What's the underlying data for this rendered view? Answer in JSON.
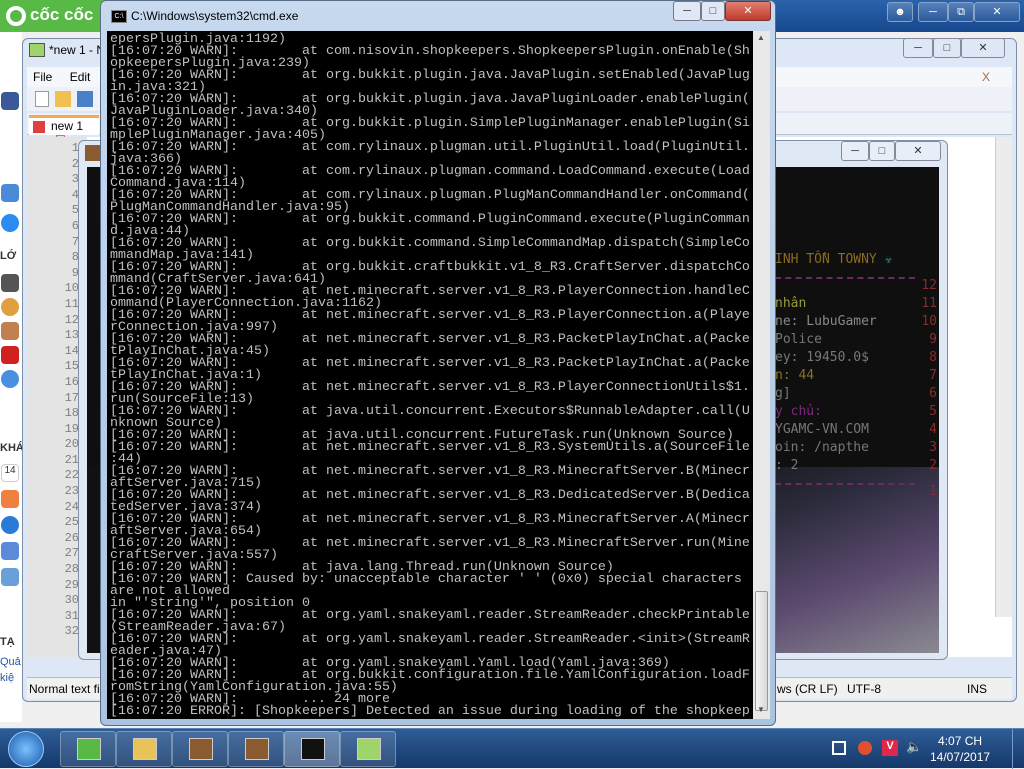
{
  "browser": {
    "logo": "cốc cốc"
  },
  "left_strip": {
    "labels": [
      "LỚ",
      "KHÁ",
      "TẠ",
      "Quả",
      "kiệ"
    ],
    "calendar_day": "14"
  },
  "notepad": {
    "title": "*new 1 - N",
    "menu": [
      "File",
      "Edit"
    ],
    "tab": "new 1",
    "line_numbers": [
      "1",
      "2",
      "3",
      "4",
      "5",
      "6",
      "7",
      "8",
      "9",
      "10",
      "11",
      "12",
      "13",
      "14",
      "15",
      "16",
      "17",
      "18",
      "19",
      "20",
      "21",
      "22",
      "23",
      "24",
      "25",
      "26",
      "27",
      "28",
      "29",
      "30",
      "31",
      "32"
    ],
    "status": {
      "type": "Normal text fi",
      "eol": "ws (CR LF)",
      "encoding": "UTF-8",
      "mode": "INS"
    }
  },
  "game": {
    "scoreboard": {
      "title": "INH TỒN TOWNY",
      "rows": [
        {
          "text": "nhân",
          "num": "11",
          "color": "#9a9a3a"
        },
        {
          "text": "ne: LubuGamer",
          "num": "10",
          "color": "#888"
        },
        {
          "text": "Police",
          "num": "9",
          "color": "#777"
        },
        {
          "text": "ey: 19450.0$",
          "num": "8",
          "color": "#777"
        },
        {
          "text": "n: 44",
          "num": "7",
          "color": "#8a7020"
        },
        {
          "text": "g]",
          "num": "6",
          "color": "#777"
        },
        {
          "text": "y chủ:",
          "num": "5",
          "color": "#7a2a7a"
        },
        {
          "text": "YGAMC-VN.COM",
          "num": "4",
          "color": "#777"
        },
        {
          "text": "oin: /napthe",
          "num": "3",
          "color": "#777"
        },
        {
          "text": ": 2",
          "num": "2",
          "color": "#777"
        }
      ],
      "top_num": "12",
      "bottom_num": "1"
    }
  },
  "cmd": {
    "title": "C:\\Windows\\system32\\cmd.exe",
    "rows": [
      "epersPlugin.java:1192)",
      "[16:07:20 WARN]:        at com.nisovin.shopkeepers.ShopkeepersPlugin.onEnable(Sh",
      "opkeepersPlugin.java:239)",
      "[16:07:20 WARN]:        at org.bukkit.plugin.java.JavaPlugin.setEnabled(JavaPlug",
      "in.java:321)",
      "[16:07:20 WARN]:        at org.bukkit.plugin.java.JavaPluginLoader.enablePlugin(",
      "JavaPluginLoader.java:340)",
      "[16:07:20 WARN]:        at org.bukkit.plugin.SimplePluginManager.enablePlugin(Si",
      "mplePluginManager.java:405)",
      "[16:07:20 WARN]:        at com.rylinaux.plugman.util.PluginUtil.load(PluginUtil.",
      "java:366)",
      "[16:07:20 WARN]:        at com.rylinaux.plugman.command.LoadCommand.execute(Load",
      "Command.java:114)",
      "[16:07:20 WARN]:        at com.rylinaux.plugman.PlugManCommandHandler.onCommand(",
      "PlugManCommandHandler.java:95)",
      "[16:07:20 WARN]:        at org.bukkit.command.PluginCommand.execute(PluginComman",
      "d.java:44)",
      "[16:07:20 WARN]:        at org.bukkit.command.SimpleCommandMap.dispatch(SimpleCo",
      "mmandMap.java:141)",
      "[16:07:20 WARN]:        at org.bukkit.craftbukkit.v1_8_R3.CraftServer.dispatchCo",
      "mmand(CraftServer.java:641)",
      "[16:07:20 WARN]:        at net.minecraft.server.v1_8_R3.PlayerConnection.handleC",
      "ommand(PlayerConnection.java:1162)",
      "[16:07:20 WARN]:        at net.minecraft.server.v1_8_R3.PlayerConnection.a(Playe",
      "rConnection.java:997)",
      "[16:07:20 WARN]:        at net.minecraft.server.v1_8_R3.PacketPlayInChat.a(Packe",
      "tPlayInChat.java:45)",
      "[16:07:20 WARN]:        at net.minecraft.server.v1_8_R3.PacketPlayInChat.a(Packe",
      "tPlayInChat.java:1)",
      "[16:07:20 WARN]:        at net.minecraft.server.v1_8_R3.PlayerConnectionUtils$1.",
      "run(SourceFile:13)",
      "[16:07:20 WARN]:        at java.util.concurrent.Executors$RunnableAdapter.call(U",
      "nknown Source)",
      "[16:07:20 WARN]:        at java.util.concurrent.FutureTask.run(Unknown Source)",
      "[16:07:20 WARN]:        at net.minecraft.server.v1_8_R3.SystemUtils.a(SourceFile",
      ":44)",
      "[16:07:20 WARN]:        at net.minecraft.server.v1_8_R3.MinecraftServer.B(Minecr",
      "aftServer.java:715)",
      "[16:07:20 WARN]:        at net.minecraft.server.v1_8_R3.DedicatedServer.B(Dedica",
      "tedServer.java:374)",
      "[16:07:20 WARN]:        at net.minecraft.server.v1_8_R3.MinecraftServer.A(Minecr",
      "aftServer.java:654)",
      "[16:07:20 WARN]:        at net.minecraft.server.v1_8_R3.MinecraftServer.run(Mine",
      "craftServer.java:557)",
      "[16:07:20 WARN]:        at java.lang.Thread.run(Unknown Source)",
      "[16:07:20 WARN]: Caused by: unacceptable character ' ' (0x0) special characters",
      "are not allowed",
      "in \"'string'\", position 0",
      "[16:07:20 WARN]:        at org.yaml.snakeyaml.reader.StreamReader.checkPrintable",
      "(StreamReader.java:67)",
      "[16:07:20 WARN]:        at org.yaml.snakeyaml.reader.StreamReader.<init>(StreamR",
      "eader.java:47)",
      "[16:07:20 WARN]:        at org.yaml.snakeyaml.Yaml.load(Yaml.java:369)",
      "[16:07:20 WARN]:        at org.bukkit.configuration.file.YamlConfiguration.loadF",
      "romString(YamlConfiguration.java:55)",
      "[16:07:20 WARN]:        ... 24 more",
      "[16:07:20 ERROR]: [Shopkeepers] Detected an issue during loading of the shopkeep"
    ]
  },
  "taskbar": {
    "items": [
      {
        "icon": "coccoc-icon",
        "color": "#58b947"
      },
      {
        "icon": "explorer-icon",
        "color": "#e8c35a"
      },
      {
        "icon": "minecraft-icon",
        "color": "#8a5a30"
      },
      {
        "icon": "minecraft-icon",
        "color": "#8a5a30"
      },
      {
        "icon": "cmd-icon",
        "color": "#111111",
        "active": true
      },
      {
        "icon": "notepadpp-icon",
        "color": "#9fd46a"
      }
    ],
    "time": "4:07 CH",
    "date": "14/07/2017"
  }
}
